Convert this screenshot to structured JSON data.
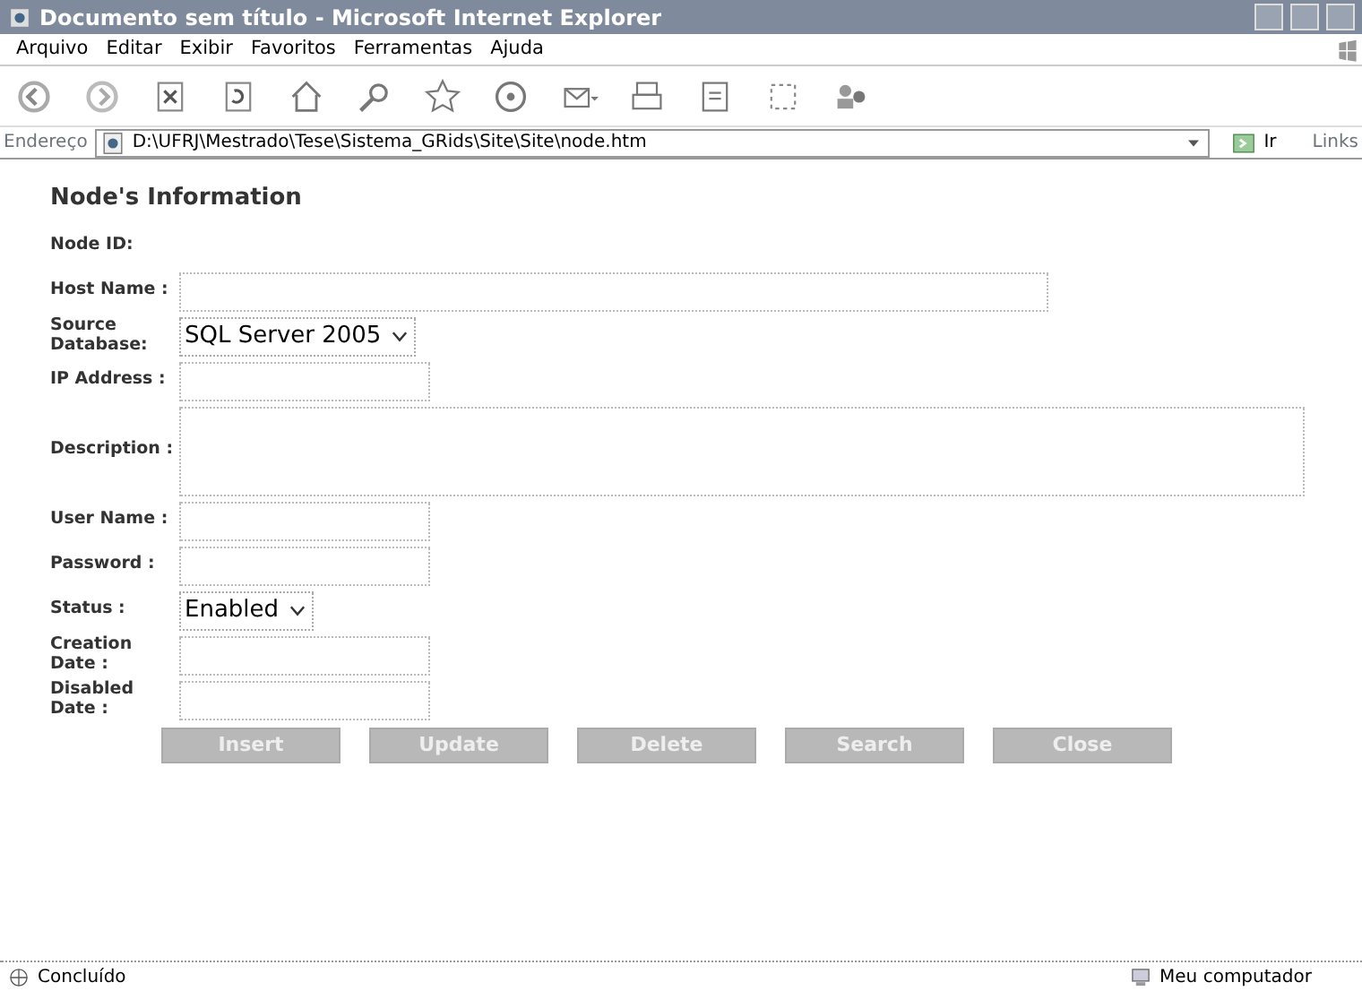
{
  "window": {
    "title": "Documento sem título - Microsoft Internet Explorer"
  },
  "menu": [
    "Arquivo",
    "Editar",
    "Exibir",
    "Favoritos",
    "Ferramentas",
    "Ajuda"
  ],
  "address_bar": {
    "label": "Endereço",
    "value": "D:\\UFRJ\\Mestrado\\Tese\\Sistema_GRids\\Site\\Site\\node.htm",
    "go": "Ir",
    "links": "Links"
  },
  "page": {
    "heading": "Node's Information",
    "fields": [
      {
        "label": "Node ID:",
        "kind": "none"
      },
      {
        "label": "Host Name :",
        "kind": "wide"
      },
      {
        "label": "Source Database:",
        "kind": "select",
        "value": "SQL Server 2005"
      },
      {
        "label": "IP Address :",
        "kind": "short"
      },
      {
        "label": "Description :",
        "kind": "textarea"
      },
      {
        "label": "User Name :",
        "kind": "short"
      },
      {
        "label": "Password :",
        "kind": "short"
      },
      {
        "label": "Status :",
        "kind": "select",
        "value": "Enabled"
      },
      {
        "label": "Creation Date :",
        "kind": "short"
      },
      {
        "label": "Disabled Date :",
        "kind": "short"
      }
    ],
    "buttons": [
      {
        "label": "Insert",
        "disabled": true
      },
      {
        "label": "Update",
        "disabled": true
      },
      {
        "label": "Delete",
        "disabled": true
      },
      {
        "label": "Search",
        "disabled": true
      },
      {
        "label": "Close",
        "disabled": true
      }
    ]
  },
  "status_bar": {
    "text": "Concluído",
    "zone": "Meu computador"
  }
}
